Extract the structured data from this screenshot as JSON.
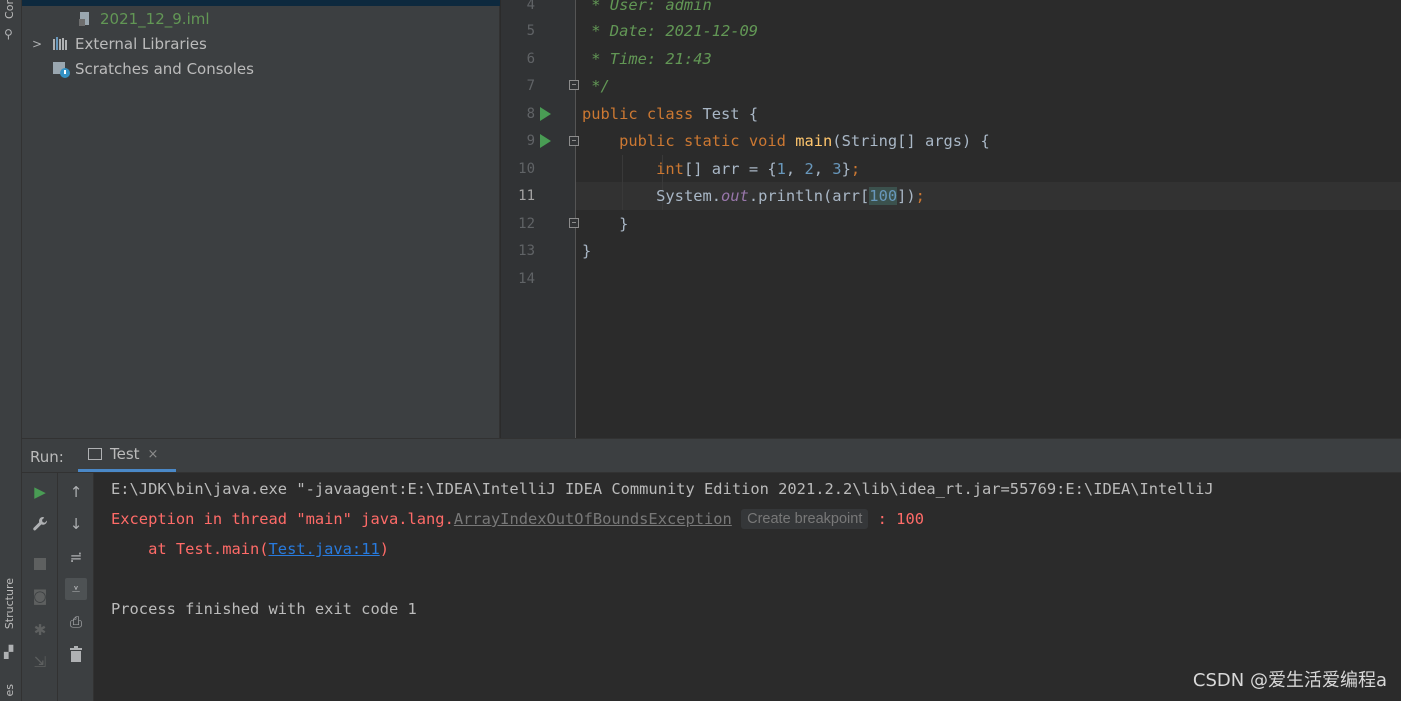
{
  "left_strip": {
    "top_label": "Cor",
    "structure_label": "Structure",
    "bottom_label": "es"
  },
  "project_tree": {
    "items": [
      {
        "label": "2021_12_9.iml",
        "color": "#629755"
      },
      {
        "label": "External Libraries",
        "color": "#bbbbbb"
      },
      {
        "label": "Scratches and Consoles",
        "color": "#bbbbbb"
      }
    ]
  },
  "editor": {
    "line_numbers": [
      "4",
      "5",
      "6",
      "7",
      "8",
      "9",
      "10",
      "11",
      "12",
      "13",
      "14"
    ],
    "current_line": "11",
    "comment": {
      "user": " * User: admin",
      "date": " * Date: 2021-12-09",
      "time": " * Time: 21:43",
      "end": " */"
    },
    "line8": {
      "kw1": "public",
      "kw2": "class",
      "name": " Test {"
    },
    "line9": {
      "kw1": "public",
      "kw2": "static",
      "kw3": "void",
      "fn": "main",
      "rest": "(String[] args) {"
    },
    "line10": {
      "kw": "int",
      "rest1": "[] arr = {",
      "n1": "1",
      "c1": ", ",
      "n2": "2",
      "c2": ", ",
      "n3": "3",
      "rest2": "}",
      "semi": ";"
    },
    "line11": {
      "pre": "System.",
      "field": "out",
      "mid": ".println(arr[",
      "num": "100",
      "post": "])",
      "semi": ";"
    },
    "line12": "}",
    "line13": "}"
  },
  "run_window": {
    "label": "Run:",
    "tab_label": "Test",
    "tab_close": "×"
  },
  "console": {
    "cmd_line": "E:\\JDK\\bin\\java.exe \"-javaagent:E:\\IDEA\\IntelliJ IDEA Community Edition 2021.2.2\\lib\\idea_rt.jar=55769:E:\\IDEA\\IntelliJ",
    "exception_prefix": "Exception in thread \"main\" java.lang.",
    "exception_class": "ArrayIndexOutOfBoundsException",
    "breakpoint_hint": "Create breakpoint",
    "exception_suffix": " : 100",
    "at_prefix": "    at Test.main(",
    "at_link": "Test.java:11",
    "at_suffix": ")",
    "finish": "Process finished with exit code 1"
  },
  "watermark": "CSDN @爱生活爱编程a",
  "icons": {
    "run": "play-icon",
    "settings": "wrench-icon",
    "stop": "stop-icon",
    "camera": "camera-icon",
    "debug": "bug-icon",
    "exit": "exit-icon",
    "up": "arrow-up-icon",
    "down": "arrow-down-icon",
    "wrap": "soft-wrap-icon",
    "scroll": "scroll-to-end-icon",
    "print": "print-icon",
    "trash": "trash-icon"
  },
  "colors": {
    "error": "#ff6b68",
    "link": "#287bde",
    "keyword": "#cc7832",
    "comment": "#629755",
    "number": "#6897bb"
  }
}
